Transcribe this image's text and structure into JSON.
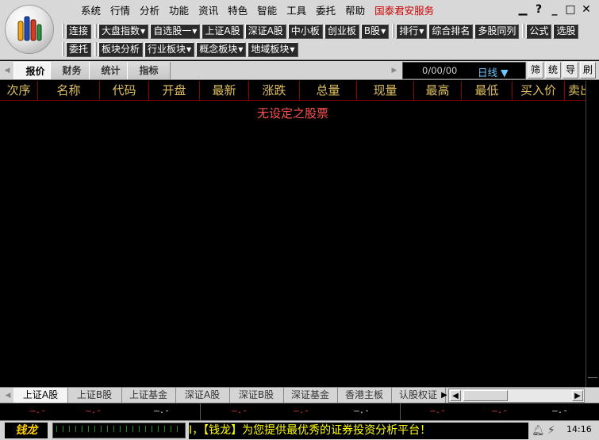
{
  "menu": [
    "系统",
    "行情",
    "分析",
    "功能",
    "资讯",
    "特色",
    "智能",
    "工具",
    "委托",
    "帮助"
  ],
  "brand_service": "国泰君安服务",
  "window_controls": {
    "minimize": "▁",
    "help": "?",
    "restore": "_",
    "maximize": "□",
    "close": "✕"
  },
  "toolbar_row1": [
    {
      "label": "连接",
      "dropdown": false
    },
    {
      "label": "大盘指数",
      "dropdown": true
    },
    {
      "label": "自选股一",
      "dropdown": true
    },
    {
      "label": "上证A股",
      "dropdown": false
    },
    {
      "label": "深证A股",
      "dropdown": false
    },
    {
      "label": "中小板",
      "dropdown": false
    },
    {
      "label": "创业板",
      "dropdown": false
    },
    {
      "label": "B股",
      "dropdown": true
    },
    {
      "label": "排行",
      "dropdown": true
    },
    {
      "label": "综合排名",
      "dropdown": false
    },
    {
      "label": "多股同列",
      "dropdown": false
    },
    {
      "label": "公式",
      "dropdown": false
    },
    {
      "label": "选股",
      "dropdown": false
    }
  ],
  "toolbar_row2": [
    {
      "label": "委托",
      "dropdown": false
    },
    {
      "label": "板块分析",
      "dropdown": false
    },
    {
      "label": "行业板块",
      "dropdown": true
    },
    {
      "label": "概念板块",
      "dropdown": true
    },
    {
      "label": "地域板块",
      "dropdown": true
    }
  ],
  "view_tabs": [
    "报价",
    "财务",
    "统计",
    "指标"
  ],
  "active_view_tab": "报价",
  "date_display": "0/00/00",
  "period": "日线 ▼",
  "side_buttons": [
    "筛",
    "统",
    "导",
    "刷"
  ],
  "columns": [
    "次序",
    "名称",
    "代码",
    "开盘",
    "最新",
    "涨跌",
    "总量",
    "现量",
    "最高",
    "最低",
    "买入价",
    "卖出价"
  ],
  "empty_message": "无设定之股票",
  "market_tabs": [
    "上证A股",
    "上证B股",
    "上证基金",
    "深证A股",
    "深证B股",
    "深证基金",
    "香港主板",
    "认股权证"
  ],
  "active_market_tab": "上证A股",
  "index_values": [
    {
      "text": "—.-",
      "color": "#ff4040"
    },
    {
      "text": "—.-",
      "color": "#ff4040"
    },
    {
      "text": "—.-",
      "color": "#e0e0e0"
    },
    {
      "text": "—.-",
      "color": "#ff4040"
    },
    {
      "text": "—.-",
      "color": "#ff4040"
    },
    {
      "text": "—.-",
      "color": "#e0e0e0"
    },
    {
      "text": "—.-",
      "color": "#ff4040"
    },
    {
      "text": "—.-",
      "color": "#ff4040"
    },
    {
      "text": "—.-",
      "color": "#e0e0e0"
    }
  ],
  "status_brand": "钱龙",
  "ticker_text": "I，【钱龙】为您提供最优秀的证券投资分析平台！",
  "clock": "14:16",
  "colors": {
    "header_text": "#e0c060",
    "grid_line": "#8b0000",
    "empty_message": "#ff5050",
    "ticker": "#ffff00",
    "period": "#6ec7ff"
  }
}
